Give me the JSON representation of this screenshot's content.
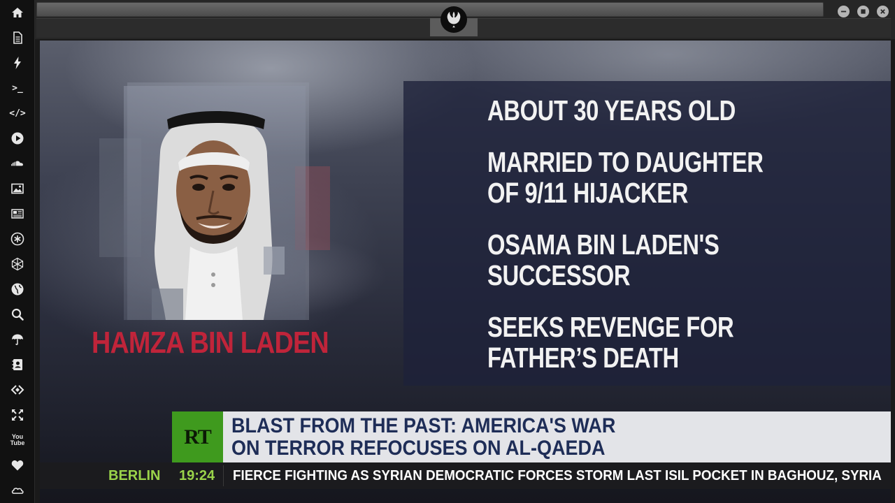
{
  "sidebar": {
    "items": [
      {
        "icon": "home-icon"
      },
      {
        "icon": "document-icon"
      },
      {
        "icon": "lightning-icon"
      },
      {
        "icon": "terminal-icon",
        "glyph": ">_"
      },
      {
        "icon": "code-icon",
        "glyph": "</>"
      },
      {
        "icon": "play-icon"
      },
      {
        "icon": "soundcloud-icon"
      },
      {
        "icon": "image-icon"
      },
      {
        "icon": "news-icon"
      },
      {
        "icon": "asterisk-icon"
      },
      {
        "icon": "hexagon-icon"
      },
      {
        "icon": "globe-icon"
      },
      {
        "icon": "search-icon"
      },
      {
        "icon": "umbrella-icon"
      },
      {
        "icon": "contacts-icon"
      },
      {
        "icon": "share-icon"
      },
      {
        "icon": "expand-icon"
      },
      {
        "icon": "youtube-icon",
        "glyph": "You\nTube"
      },
      {
        "icon": "heart-icon"
      },
      {
        "icon": "cloud-icon"
      }
    ]
  },
  "window": {
    "logo_icon": "rebel-alliance-icon",
    "controls": [
      "minimize-icon",
      "maximize-icon",
      "close-icon"
    ]
  },
  "video": {
    "name_caption": "HAMZA BIN LADEN",
    "facts": [
      "ABOUT 30 YEARS OLD",
      "MARRIED TO DAUGHTER",
      "OF 9/11 HIJACKER",
      "OSAMA BIN LADEN'S",
      "SUCCESSOR",
      "SEEKS REVENGE FOR",
      "FATHER’S DEATH"
    ],
    "channel_logo": "RT",
    "headline": {
      "line1": "BLAST FROM THE PAST: AMERICA'S WAR",
      "line2": "ON TERROR REFOCUSES ON AL-QAEDA"
    },
    "ticker": {
      "city": "BERLIN",
      "time": "19:24",
      "text": "FIERCE FIGHTING AS SYRIAN DEMOCRATIC FORCES STORM LAST ISIL POCKET IN BAGHOUZ, SYRIA"
    }
  },
  "colors": {
    "name_caption": "#c0243a",
    "headline_text": "#1e2d57",
    "ticker_accent": "#9ad34a",
    "rt_green": "#3f9a1e"
  }
}
